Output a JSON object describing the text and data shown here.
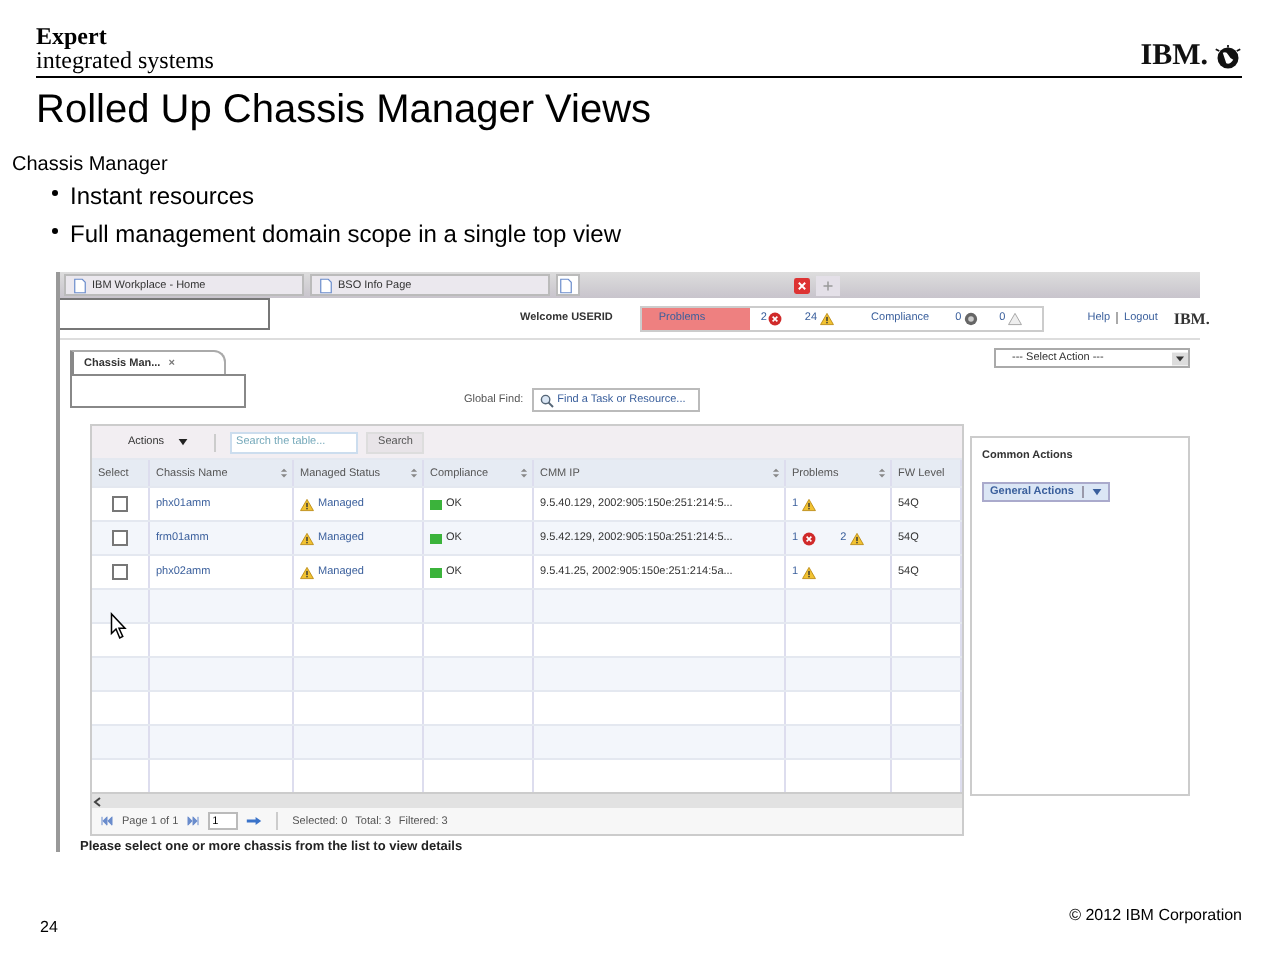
{
  "slide": {
    "brand": {
      "line_1": "Expert",
      "line_2": "integrated systems"
    },
    "logo": "IBM.",
    "title": "Rolled Up Chassis Manager Views",
    "subtitle": "Chassis Manager",
    "bullets": [
      "Instant resources",
      "Full management domain scope in a single top view"
    ],
    "page_number": "24",
    "copyright": "© 2012 IBM Corporation"
  },
  "screen": {
    "browser_tabs": [
      {
        "label": "IBM Workplace - Home",
        "selected": false
      },
      {
        "label": "BSO Info Page",
        "selected": false
      },
      {
        "selected": true
      }
    ],
    "welcome": "Welcome USERID",
    "status": [
      {
        "label": "Problems",
        "highlighted": true,
        "counts": [
          {
            "kind": "error",
            "count": "2"
          },
          {
            "kind": "warning",
            "count": "24"
          }
        ]
      },
      {
        "label": "Compliance",
        "highlighted": false,
        "counts": [
          {
            "kind": "unknown",
            "count": "0"
          },
          {
            "kind": "info",
            "count": "0"
          }
        ]
      }
    ],
    "links": [
      "Help",
      "Logout"
    ],
    "header_logo": "IBM.",
    "select_action": "--- Select Action ---",
    "page_tab": {
      "label": "Chassis Man...",
      "close": "×"
    },
    "global_find": {
      "label": "Global Find:",
      "placeholder": "Find a Task or Resource..."
    },
    "table": {
      "actions": "Actions",
      "search_placeholder": "Search the table...",
      "search_button": "Search",
      "columns": [
        {
          "label": "Select",
          "sortable": false
        },
        {
          "label": "Chassis Name",
          "sortable": true
        },
        {
          "label": "Managed Status",
          "sortable": true
        },
        {
          "label": "Compliance",
          "sortable": true
        },
        {
          "label": "CMM IP",
          "sortable": true
        },
        {
          "label": "Problems",
          "sortable": true
        },
        {
          "label": "FW Level",
          "sortable": false
        }
      ],
      "rows": [
        {
          "checked": false,
          "name": "phx01amm",
          "status": "Managed",
          "compliance": "OK",
          "cmm_ip": "9.5.40.129, 2002:905:150e:251:214:5...",
          "problems": [
            {
              "kind": "warning",
              "count": "1"
            }
          ],
          "fw_level": "54Q"
        },
        {
          "checked": false,
          "name": "frm01amm",
          "status": "Managed",
          "compliance": "OK",
          "cmm_ip": "9.5.42.129, 2002:905:150a:251:214:5...",
          "problems": [
            {
              "kind": "error",
              "count": "1"
            },
            {
              "kind": "warning",
              "count": "2"
            }
          ],
          "fw_level": "54Q"
        },
        {
          "checked": false,
          "name": "phx02amm",
          "status": "Managed",
          "compliance": "OK",
          "cmm_ip": "9.5.41.25, 2002:905:150e:251:214:5a...",
          "problems": [
            {
              "kind": "warning",
              "count": "1"
            }
          ],
          "fw_level": "54Q"
        }
      ],
      "pager": {
        "page": "Page 1 of 1",
        "page_input": "1",
        "selected": "Selected: 0",
        "total": "Total: 3",
        "filtered": "Filtered: 3"
      }
    },
    "message": "Please select one or more chassis from the list to view details",
    "common_actions": {
      "title": "Common Actions",
      "menu": "General Actions"
    }
  }
}
